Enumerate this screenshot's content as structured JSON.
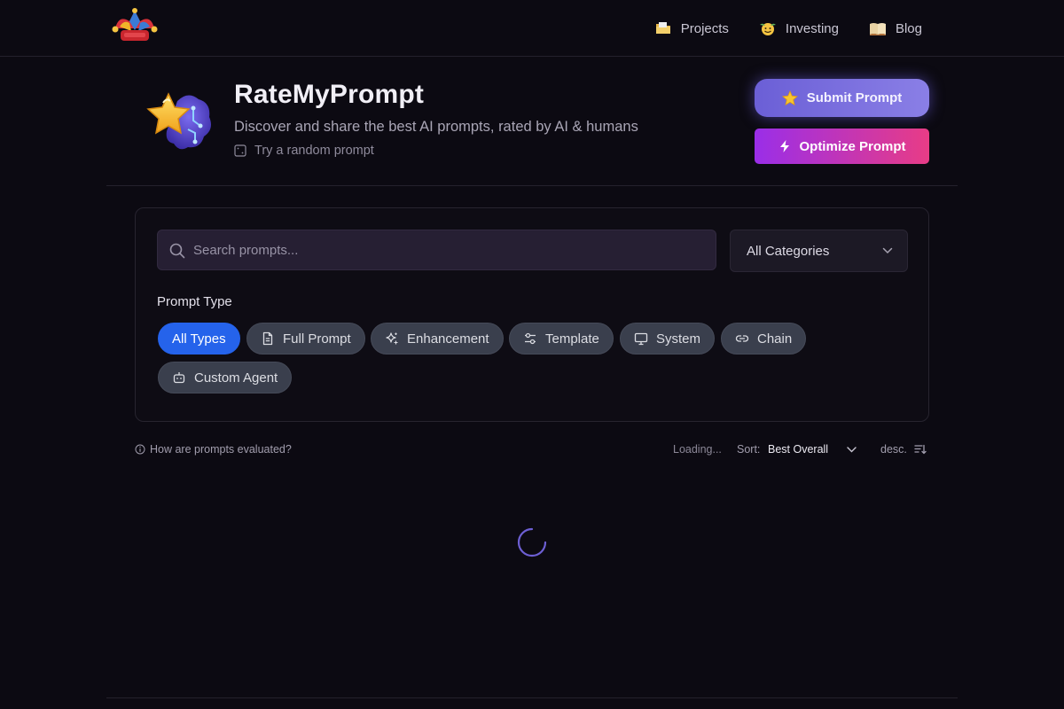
{
  "nav": {
    "links": [
      {
        "label": "Projects",
        "icon": "folder-emoji-icon"
      },
      {
        "label": "Investing",
        "icon": "money-face-emoji-icon"
      },
      {
        "label": "Blog",
        "icon": "book-emoji-icon"
      }
    ]
  },
  "hero": {
    "title": "RateMyPrompt",
    "subtitle": "Discover and share the best AI prompts, rated by AI & humans",
    "random_link": "Try a random prompt",
    "submit_label": "Submit Prompt",
    "optimize_label": "Optimize Prompt"
  },
  "filters": {
    "search_placeholder": "Search prompts...",
    "search_value": "",
    "category_selected": "All Categories",
    "type_label": "Prompt Type",
    "types": [
      {
        "label": "All Types",
        "active": true,
        "icon": ""
      },
      {
        "label": "Full Prompt",
        "active": false,
        "icon": "document-icon"
      },
      {
        "label": "Enhancement",
        "active": false,
        "icon": "sparkles-icon"
      },
      {
        "label": "Template",
        "active": false,
        "icon": "sliders-icon"
      },
      {
        "label": "System",
        "active": false,
        "icon": "monitor-icon"
      },
      {
        "label": "Chain",
        "active": false,
        "icon": "link-icon"
      },
      {
        "label": "Custom Agent",
        "active": false,
        "icon": "bot-icon"
      }
    ]
  },
  "status": {
    "eval_link": "How are prompts evaluated?",
    "loading": "Loading...",
    "sort_label": "Sort:",
    "sort_selected": "Best Overall",
    "order": "desc."
  },
  "colors": {
    "background": "#0c0a12",
    "accent_blue": "#2563eb",
    "submit_gradient_start": "#6b5fd6",
    "optimize_gradient_start": "#9a2ee8",
    "optimize_gradient_end": "#e83c86"
  }
}
